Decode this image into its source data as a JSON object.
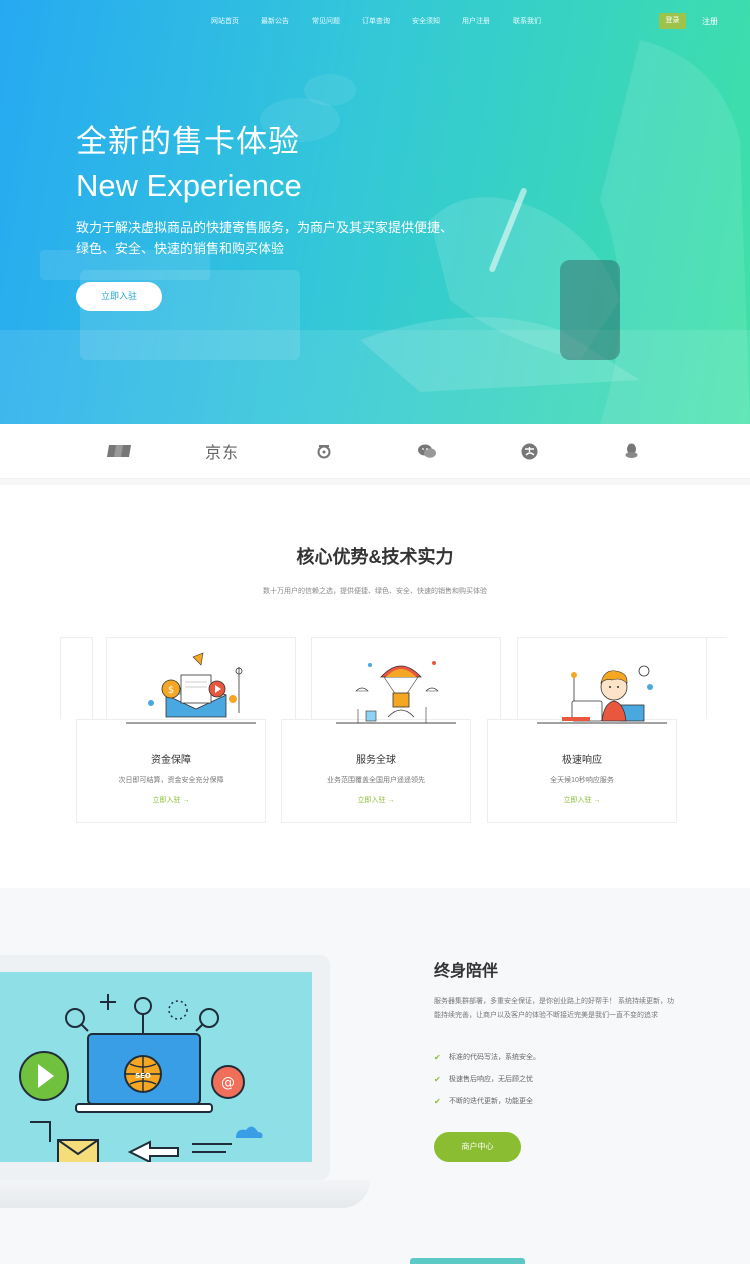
{
  "nav": {
    "items": [
      "网站首页",
      "最新公告",
      "常见问题",
      "订单查询",
      "安全须知",
      "用户注册",
      "联系我们"
    ],
    "login_label": "登录",
    "register_label": "注册"
  },
  "hero": {
    "title": "全新的售卡体验",
    "subtitle": "New Experience",
    "description": "致力于解决虚拟商品的快捷寄售服务，为商户及其买家提供便捷、绿色、安全、快速的销售和购买体验",
    "cta_label": "立即入驻"
  },
  "payment_logos": [
    {
      "name": "unionpay-logo",
      "text": ""
    },
    {
      "name": "jd-logo",
      "text": "京东"
    },
    {
      "name": "tenpay-logo",
      "text": ""
    },
    {
      "name": "wechat-logo",
      "text": ""
    },
    {
      "name": "alipay-logo",
      "text": ""
    },
    {
      "name": "qq-logo",
      "text": ""
    }
  ],
  "core": {
    "title": "核心优势&技术实力",
    "description": "数十万用户的信赖之选，提供便捷、绿色、安全、快速的销售和购买体验",
    "cards": [
      {
        "name": "资金保障",
        "text": "次日即可结算，资金安全充分保障",
        "link": "立即入驻 →"
      },
      {
        "name": "服务全球",
        "text": "业务范围覆盖全国用户遥遥领先",
        "link": "立即入驻 →"
      },
      {
        "name": "极速响应",
        "text": "全天候10秒响应服务",
        "link": "立即入驻 →"
      }
    ]
  },
  "lifetime": {
    "title": "终身陪伴",
    "description": "服务器集群部署，多重安全保证，是你创业路上的好帮手！ 系统持续更新，功能持续完善，让商户以及客户的体验不断接近完美是我们一直不变的追求",
    "features": [
      "标准的代码写法，系统安全。",
      "极速售后响应，无后顾之忧",
      "不断的迭代更新，功能更全"
    ],
    "cta_label": "商户中心"
  },
  "colors": {
    "hero_start": "#27a9f2",
    "hero_end": "#3fe1a6",
    "accent_green": "#8bbd32",
    "login_green": "#9cc44a"
  }
}
